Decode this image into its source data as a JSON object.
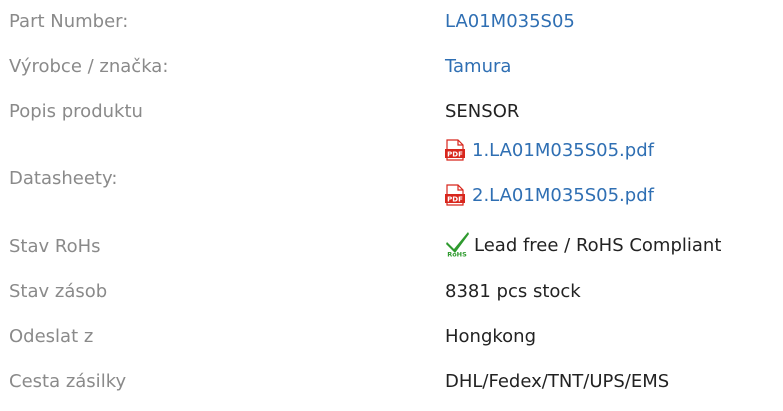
{
  "specs": {
    "part_number": {
      "label": "Part Number:",
      "value": "LA01M035S05"
    },
    "manufacturer": {
      "label": "Výrobce / značka:",
      "value": "Tamura"
    },
    "description": {
      "label": "Popis produktu",
      "value": "SENSOR"
    },
    "datasheets": {
      "label": "Datasheety:",
      "files": [
        {
          "text": "1.LA01M035S05.pdf",
          "icon": "pdf-icon"
        },
        {
          "text": "2.LA01M035S05.pdf",
          "icon": "pdf-icon"
        }
      ]
    },
    "rohs": {
      "label": "Stav RoHs",
      "value": "Lead free / RoHS Compliant",
      "icon": "rohs-icon"
    },
    "stock": {
      "label": "Stav zásob",
      "value": "8381 pcs stock"
    },
    "ship_from": {
      "label": "Odeslat z",
      "value": "Hongkong"
    },
    "shipping": {
      "label": "Cesta zásilky",
      "value": "DHL/Fedex/TNT/UPS/EMS"
    }
  },
  "colors": {
    "label": "#8a8a8a",
    "link": "#2f6fb3",
    "text": "#222222",
    "pdf_red": "#d8261c",
    "rohs_green": "#2e9a2e"
  }
}
